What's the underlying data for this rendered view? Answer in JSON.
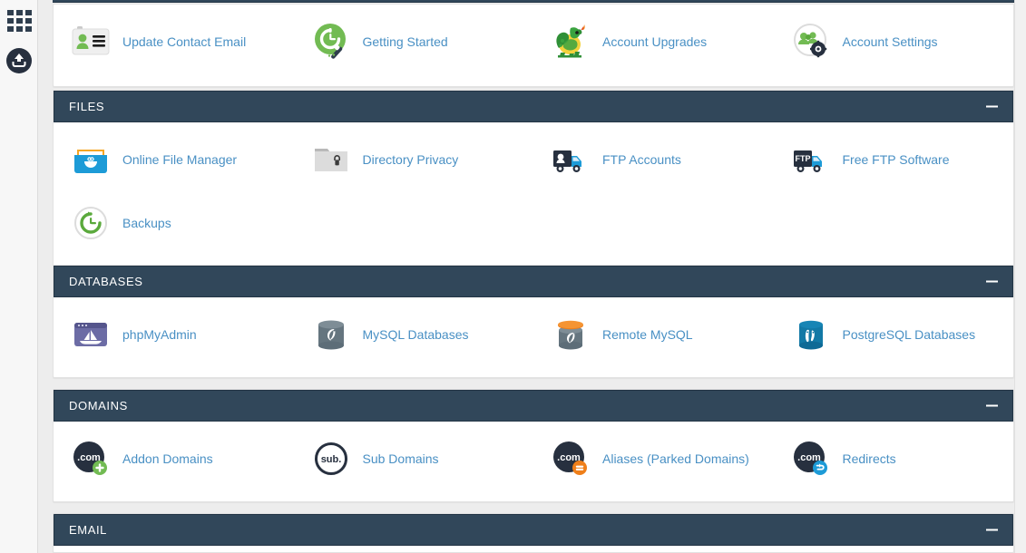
{
  "sidebar": {
    "items": [
      {
        "name": "apps-grid",
        "label": "Apps"
      },
      {
        "name": "upload",
        "label": "Upload"
      }
    ]
  },
  "topcard": {
    "tiles": [
      {
        "label": "Update Contact Email",
        "icon": "contact-card-icon"
      },
      {
        "label": "Getting Started",
        "icon": "getting-started-icon"
      },
      {
        "label": "Account Upgrades",
        "icon": "dragon-icon"
      },
      {
        "label": "Account Settings",
        "icon": "account-settings-icon"
      }
    ]
  },
  "sections": [
    {
      "title": "FILES",
      "collapse_label": "−",
      "tiles": [
        {
          "label": "Online File Manager",
          "icon": "file-manager-icon"
        },
        {
          "label": "Directory Privacy",
          "icon": "directory-privacy-icon"
        },
        {
          "label": "FTP Accounts",
          "icon": "ftp-accounts-icon"
        },
        {
          "label": "Free FTP Software",
          "icon": "free-ftp-software-icon"
        },
        {
          "label": "Backups",
          "icon": "backups-icon"
        }
      ]
    },
    {
      "title": "DATABASES",
      "collapse_label": "−",
      "tiles": [
        {
          "label": "phpMyAdmin",
          "icon": "phpmyadmin-icon"
        },
        {
          "label": "MySQL Databases",
          "icon": "mysql-databases-icon"
        },
        {
          "label": "Remote MySQL",
          "icon": "remote-mysql-icon"
        },
        {
          "label": "PostgreSQL Databases",
          "icon": "postgresql-databases-icon"
        }
      ]
    },
    {
      "title": "DOMAINS",
      "collapse_label": "−",
      "tiles": [
        {
          "label": "Addon Domains",
          "icon": "addon-domains-icon"
        },
        {
          "label": "Sub Domains",
          "icon": "sub-domains-icon"
        },
        {
          "label": "Aliases (Parked Domains)",
          "icon": "aliases-icon"
        },
        {
          "label": "Redirects",
          "icon": "redirects-icon"
        }
      ]
    },
    {
      "title": "EMAIL",
      "collapse_label": "−",
      "tiles": []
    }
  ],
  "colors": {
    "header_bg": "#31475a",
    "page_bg": "#ededed",
    "link": "#4990c4",
    "accent_green": "#72bb53",
    "accent_orange": "#ef7f1a",
    "accent_blue": "#1d9bd7",
    "dark_navy": "#273746"
  }
}
